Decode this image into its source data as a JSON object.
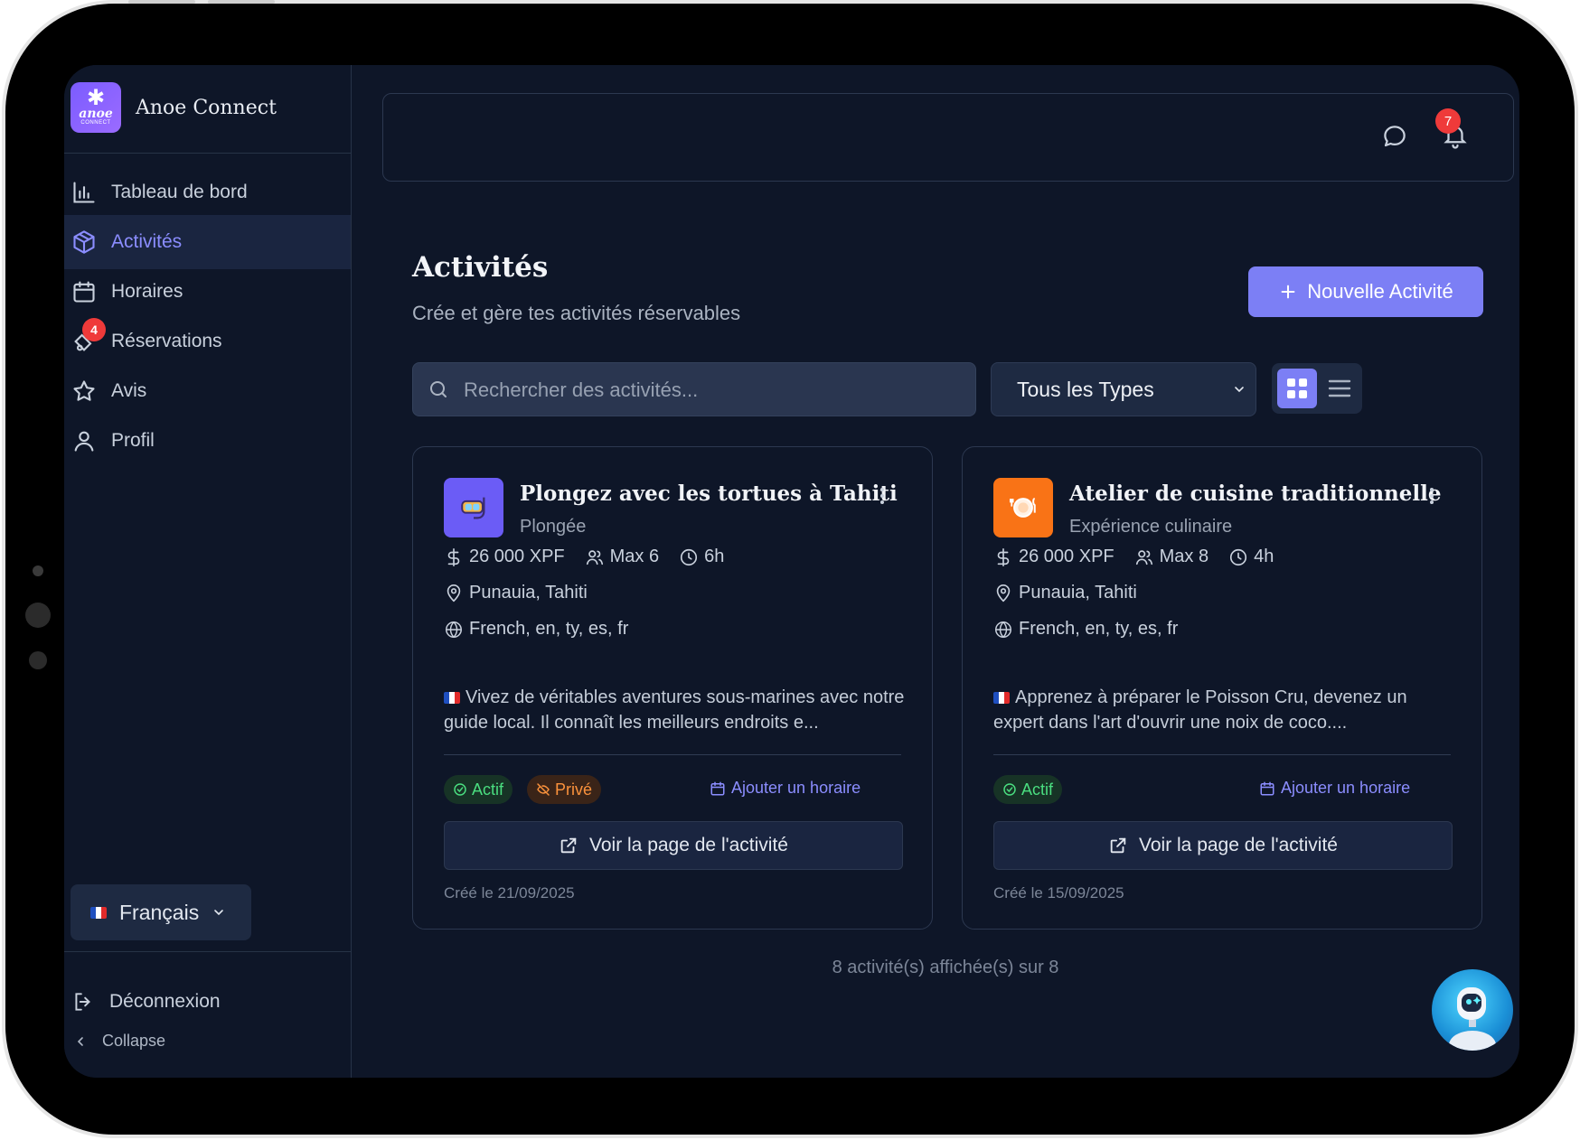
{
  "app": {
    "brand_name": "Anoe Connect",
    "logo_text_top": "anoe",
    "logo_text_bottom": "CONNECT",
    "accent": "#7c7ff5"
  },
  "sidebar": {
    "items": [
      {
        "label": "Tableau de bord",
        "icon": "bar-chart-icon"
      },
      {
        "label": "Activités",
        "icon": "package-icon",
        "active": true
      },
      {
        "label": "Horaires",
        "icon": "calendar-icon"
      },
      {
        "label": "Réservations",
        "icon": "tickets-icon",
        "badge": "4"
      },
      {
        "label": "Avis",
        "icon": "star-icon"
      },
      {
        "label": "Profil",
        "icon": "user-icon"
      }
    ],
    "language": "Français",
    "logout": "Déconnexion",
    "collapse": "Collapse"
  },
  "topbar": {
    "notification_count": "7"
  },
  "header": {
    "title": "Activités",
    "subtitle": "Crée et gère tes activités réservables",
    "new_button": "Nouvelle Activité"
  },
  "filters": {
    "search_placeholder": "Rechercher des activités...",
    "type_selected": "Tous les Types"
  },
  "cards": [
    {
      "title": "Plongez avec les tortues à Tahiti",
      "category": "Plongée",
      "price": "26 000 XPF",
      "capacity": "Max 6",
      "duration": "6h",
      "location": "Punauia, Tahiti",
      "languages": "French, en, ty, es, fr",
      "description": "Vivez de véritables aventures sous-marines avec notre guide local. Il connaît les meilleurs endroits e...",
      "status": "Actif",
      "privacy": "Privé",
      "add_schedule": "Ajouter un horaire",
      "view_page": "Voir la page de l'activité",
      "created": "Créé le 21/09/2025",
      "icon_color": "#6b5cf6"
    },
    {
      "title": "Atelier de cuisine traditionnelle",
      "category": "Expérience culinaire",
      "price": "26 000 XPF",
      "capacity": "Max 8",
      "duration": "4h",
      "location": "Punauia, Tahiti",
      "languages": "French, en, ty, es, fr",
      "description": "Apprenez à préparer le Poisson Cru, devenez un expert dans l'art d'ouvrir une noix de coco....",
      "status": "Actif",
      "add_schedule": "Ajouter un horaire",
      "view_page": "Voir la page de l'activité",
      "created": "Créé le 15/09/2025",
      "icon_color": "#f97316"
    }
  ],
  "footer": {
    "count_text": "8 activité(s) affichée(s) sur 8"
  }
}
